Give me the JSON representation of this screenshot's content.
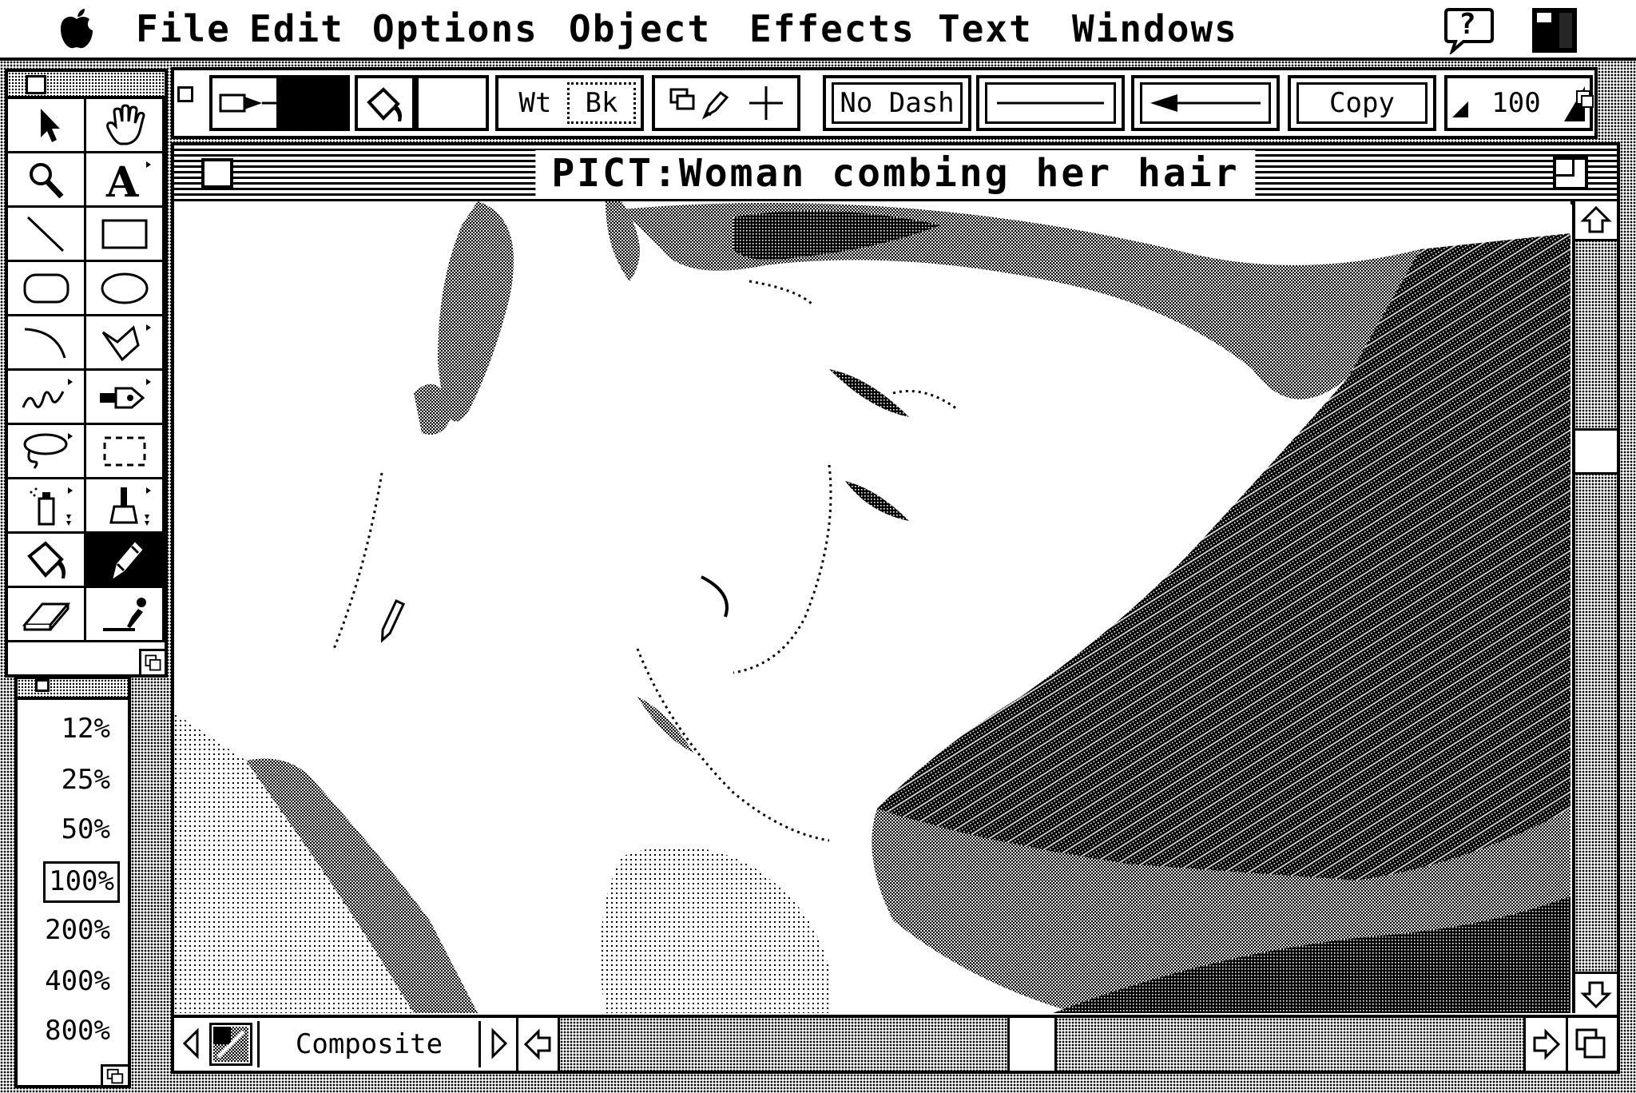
{
  "menubar": {
    "apple": "",
    "items": [
      "File",
      "Edit",
      "Options",
      "Object",
      "Effects",
      "Text",
      "Windows"
    ],
    "help_label": "?"
  },
  "toolbox": {
    "tools": [
      "arrow",
      "grabber-hand",
      "zoom",
      "text",
      "line",
      "rectangle",
      "rounded-rectangle",
      "oval",
      "arc",
      "polygon",
      "freehand",
      "pen",
      "lasso",
      "marquee",
      "spray-can",
      "paintbrush",
      "paint-bucket",
      "pencil",
      "eraser",
      "eyedropper"
    ],
    "active_tool": "pencil"
  },
  "zoom_palette": {
    "levels": [
      "12%",
      "25%",
      "50%",
      "100%",
      "200%",
      "400%",
      "800%"
    ],
    "selected": "100%"
  },
  "attributes": {
    "pen_color": "#000000",
    "fill_color": "#ffffff",
    "wt_label": "Wt",
    "bk_label": "Bk",
    "dash_label": "No Dash",
    "mode_label": "Copy",
    "opacity_value": "100"
  },
  "document": {
    "title": "PICT:Woman combing her hair",
    "layer_label": "Composite"
  }
}
